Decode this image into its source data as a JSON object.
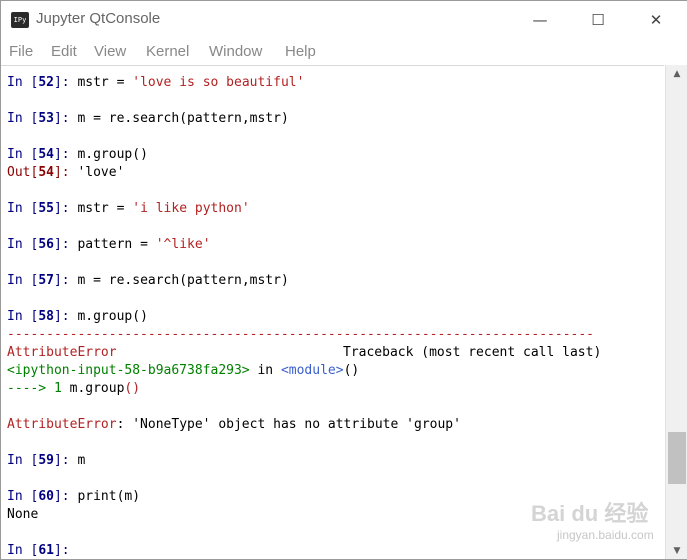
{
  "window": {
    "title": "Jupyter QtConsole",
    "icon_label": "IPy",
    "controls": {
      "minimize": "—",
      "maximize": "☐",
      "close": "✕"
    }
  },
  "menu": [
    "File",
    "Edit",
    "View",
    "Kernel",
    "Window",
    "Help"
  ],
  "console": {
    "l1": {
      "prompt": "In [",
      "num": "52",
      "end": "]: ",
      "code": "mstr = ",
      "str": "'love is so beautiful'"
    },
    "l2": {
      "prompt": "In [",
      "num": "53",
      "end": "]: ",
      "code": "m = re.search(pattern,mstr)"
    },
    "l3": {
      "prompt": "In [",
      "num": "54",
      "end": "]: ",
      "code": "m.group()"
    },
    "l4": {
      "prompt": "Out[",
      "num": "54",
      "end": "]: ",
      "code": "'love'"
    },
    "l5": {
      "prompt": "In [",
      "num": "55",
      "end": "]: ",
      "code": "mstr = ",
      "str": "'i like python'"
    },
    "l6": {
      "prompt": "In [",
      "num": "56",
      "end": "]: ",
      "code": "pattern = ",
      "str": "'^like'"
    },
    "l7": {
      "prompt": "In [",
      "num": "57",
      "end": "]: ",
      "code": "m = re.search(pattern,mstr)"
    },
    "l8": {
      "prompt": "In [",
      "num": "58",
      "end": "]: ",
      "code": "m.group()"
    },
    "separator": "---------------------------------------------------------------------------",
    "tb_error": "AttributeError",
    "tb_traceback": "Traceback (most recent call last)",
    "tb_input": "<ipython-input-58-b9a6738fa293>",
    "tb_in": " in ",
    "tb_module": "<module>",
    "tb_paren": "()",
    "tb_arrow": "----> 1 ",
    "tb_code1": "m.group",
    "tb_code2": "()",
    "err_name": "AttributeError",
    "err_msg": ": 'NoneType' object has no attribute 'group'",
    "l9": {
      "prompt": "In [",
      "num": "59",
      "end": "]: ",
      "code": "m"
    },
    "l10": {
      "prompt": "In [",
      "num": "60",
      "end": "]: ",
      "code": "print(m)"
    },
    "out_none": "None",
    "l11": {
      "prompt": "In [",
      "num": "61",
      "end": "]: "
    }
  },
  "watermark": {
    "main": "Bai du 经验",
    "sub": "jingyan.baidu.com"
  }
}
